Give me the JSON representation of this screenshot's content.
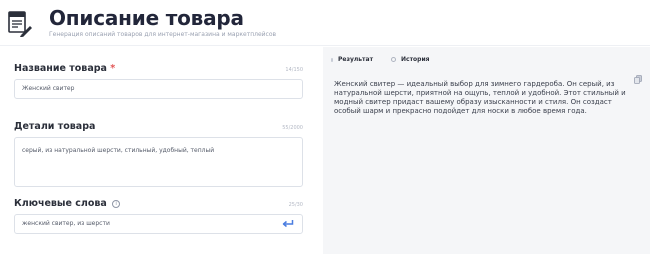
{
  "header": {
    "title": "Описание товара",
    "subtitle": "Генерация описаний товаров для интернет-магазина и маркетплейсов",
    "logo_icon": "document-writing-icon"
  },
  "form": {
    "name_field": {
      "label": "Название товара",
      "required_mark": "*",
      "counter": "14/150",
      "value": "Женский свитер"
    },
    "details_field": {
      "label": "Детали товара",
      "counter": "55/2000",
      "value": "серый, из натуральной шерсти, стильный, удобный, теплый"
    },
    "keywords_field": {
      "label": "Ключевые слова",
      "info_glyph": "i",
      "counter": "25/30",
      "value": "женский свитер, из шерсти",
      "submit_icon": "enter-arrow-icon"
    }
  },
  "result_panel": {
    "tabs": [
      {
        "label": "Результат",
        "active": true
      },
      {
        "label": "История",
        "active": false
      }
    ],
    "text": "Женский свитер — идеальный выбор для зимнего гардероба. Он серый, из натуральной шерсти, приятной на ощупь, теплой и удобной. Этот стильный и модный свитер придаст вашему образу изысканности и стиля. Он создаст особый шарм и прекрасно подойдет для носки в любое время года.",
    "copy_icon": "copy-icon"
  },
  "colors": {
    "accent": "#4a7de0",
    "required": "#e25656",
    "panel_bg": "#f5f6f8"
  }
}
